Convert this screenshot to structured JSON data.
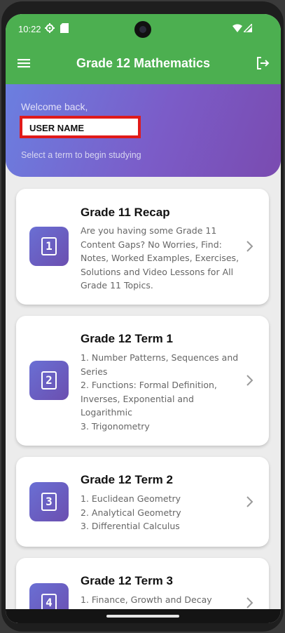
{
  "status_bar": {
    "time": "10:22",
    "icons": [
      "gear-icon",
      "sd-card-icon",
      "wifi-icon",
      "signal-icon"
    ]
  },
  "app_bar": {
    "title": "Grade 12 Mathematics",
    "left_icon": "menu-icon",
    "right_icon": "logout-icon",
    "color": "#4caf50"
  },
  "hero": {
    "welcome": "Welcome back,",
    "username": "USER NAME",
    "subtitle": "Select a term to begin studying"
  },
  "cards": [
    {
      "badge": "1",
      "title": "Grade 11 Recap",
      "description": "Are you having some Grade 11 Content Gaps? No Worries, Find: Notes, Worked Examples, Exercises, Solutions and Video Lessons for All Grade 11 Topics."
    },
    {
      "badge": "2",
      "title": "Grade 12 Term 1",
      "description": "1. Number Patterns, Sequences and Series\n2. Functions: Formal Definition, Inverses, Exponential and Logarithmic\n3. Trigonometry"
    },
    {
      "badge": "3",
      "title": "Grade 12 Term 2",
      "description": "1. Euclidean Geometry\n2. Analytical Geometry\n3. Differential Calculus"
    },
    {
      "badge": "4",
      "title": "Grade 12 Term 3",
      "description": "1. Finance, Growth and Decay"
    }
  ],
  "colors": {
    "accent_green": "#4caf50",
    "hero_gradient_start": "#6b7fe0",
    "hero_gradient_end": "#7a4bb0",
    "highlight_red": "#e01a1a"
  }
}
